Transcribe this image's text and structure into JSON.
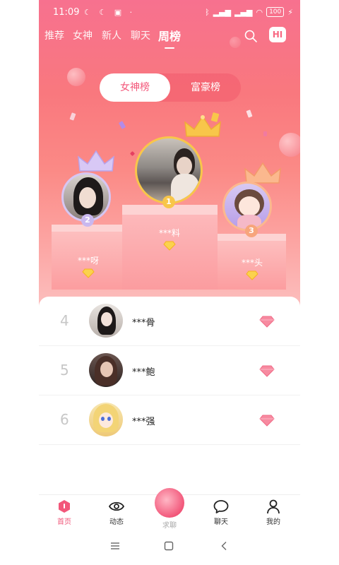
{
  "status_bar": {
    "time": "11:09",
    "battery": "100"
  },
  "top_nav": {
    "tabs": [
      {
        "label": "推荐",
        "active": false
      },
      {
        "label": "女神",
        "active": false
      },
      {
        "label": "新人",
        "active": false
      },
      {
        "label": "聊天",
        "active": false
      },
      {
        "label": "周榜",
        "active": true
      }
    ],
    "hi_label": "HI"
  },
  "toggle": {
    "selected": "女神榜",
    "other": "富豪榜"
  },
  "podium": {
    "first": {
      "rank": "1",
      "name": "***料"
    },
    "second": {
      "rank": "2",
      "name": "***呀"
    },
    "third": {
      "rank": "3",
      "name": "***头"
    }
  },
  "ranking_list": [
    {
      "rank": "4",
      "name": "***骨"
    },
    {
      "rank": "5",
      "name": "***鲍"
    },
    {
      "rank": "6",
      "name": "***强"
    }
  ],
  "bottom_nav": {
    "home": "首页",
    "moments": "动态",
    "seek_chat": "求聊",
    "chat": "聊天",
    "mine": "我的"
  },
  "colors": {
    "accent": "#f3577a",
    "gem": "#f77891",
    "crown_gold": "#f8c64a",
    "crown_purple": "#c9b2f0"
  }
}
